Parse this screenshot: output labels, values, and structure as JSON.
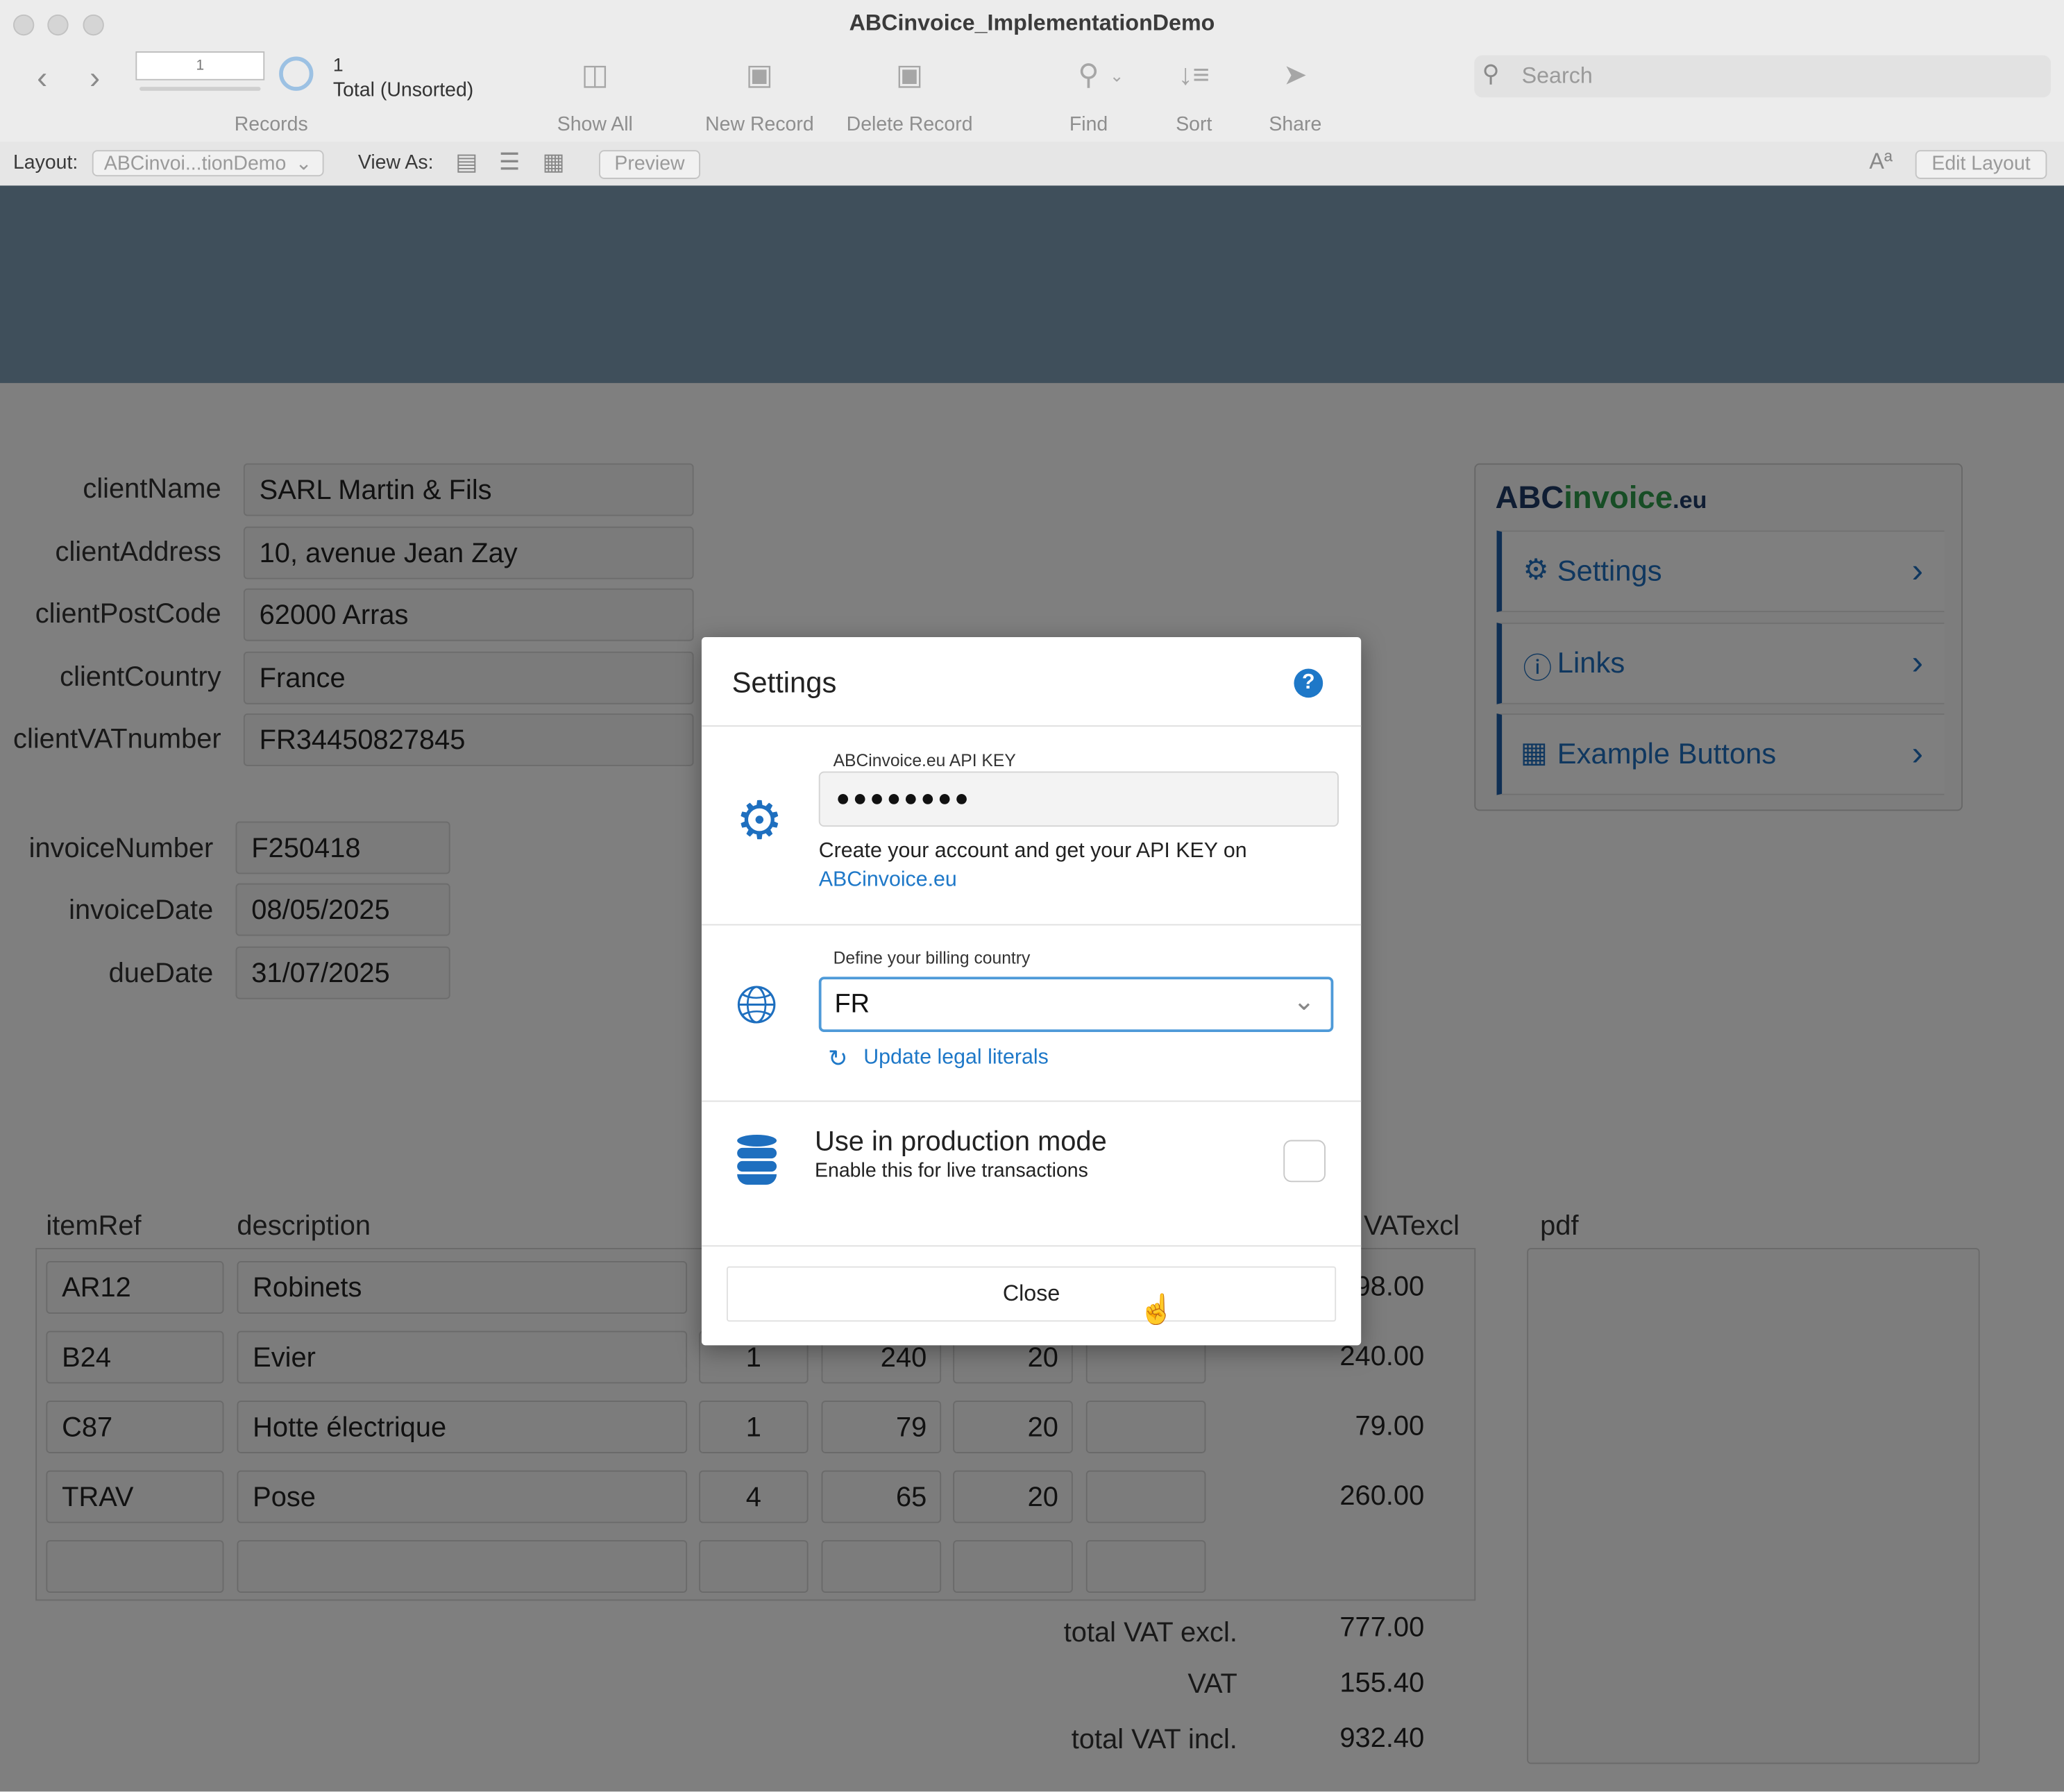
{
  "window": {
    "title": "ABCinvoice_ImplementationDemo"
  },
  "toolbar": {
    "record_current": "1",
    "record_total": "1",
    "record_status": "Total (Unsorted)",
    "records_label": "Records",
    "show_all": "Show All",
    "new_record": "New Record",
    "delete_record": "Delete Record",
    "find": "Find",
    "sort": "Sort",
    "share": "Share",
    "search_placeholder": "Search"
  },
  "layout_bar": {
    "layout_label": "Layout:",
    "layout_value": "ABCinvoi...tionDemo",
    "view_as_label": "View As:",
    "preview": "Preview",
    "font_icon_text": "Aª",
    "edit_layout": "Edit Layout"
  },
  "client": {
    "fields": [
      {
        "label": "clientName",
        "value": "SARL Martin & Fils"
      },
      {
        "label": "clientAddress",
        "value": "10, avenue Jean Zay"
      },
      {
        "label": "clientPostCode",
        "value": "62000 Arras"
      },
      {
        "label": "clientCountry",
        "value": "France"
      },
      {
        "label": "clientVATnumber",
        "value": "FR34450827845"
      }
    ]
  },
  "invoice": {
    "fields": [
      {
        "label": "invoiceNumber",
        "value": "F250418"
      },
      {
        "label": "invoiceDate",
        "value": "08/05/2025"
      },
      {
        "label": "dueDate",
        "value": "31/07/2025"
      }
    ]
  },
  "items_table": {
    "headers": {
      "itemRef": "itemRef",
      "description": "description",
      "vatexcl": "VATexcl",
      "pdf": "pdf"
    },
    "rows": [
      {
        "ref": "AR12",
        "description": "Robinets",
        "qty": "",
        "price": "",
        "vat": "",
        "discount": "",
        "total": "98.00"
      },
      {
        "ref": "B24",
        "description": "Evier",
        "qty": "1",
        "price": "240",
        "vat": "20",
        "discount": "",
        "total": "240.00"
      },
      {
        "ref": "C87",
        "description": "Hotte électrique",
        "qty": "1",
        "price": "79",
        "vat": "20",
        "discount": "",
        "total": "79.00"
      },
      {
        "ref": "TRAV",
        "description": "Pose",
        "qty": "4",
        "price": "65",
        "vat": "20",
        "discount": "",
        "total": "260.00"
      },
      {
        "ref": "",
        "description": "",
        "qty": "",
        "price": "",
        "vat": "",
        "discount": "",
        "total": ""
      }
    ]
  },
  "totals": [
    {
      "label": "total VAT excl.",
      "value": "777.00"
    },
    {
      "label": "VAT",
      "value": "155.40"
    },
    {
      "label": "total VAT incl.",
      "value": "932.40"
    }
  ],
  "abc_panel": {
    "logo_abc": "ABC",
    "logo_invoice": "invoice",
    "logo_eu": ".eu",
    "items": [
      {
        "label": "Settings",
        "icon": "gear-icon"
      },
      {
        "label": "Links",
        "icon": "info-icon"
      },
      {
        "label": "Example Buttons",
        "icon": "grid-icon"
      }
    ]
  },
  "dialog": {
    "title": "Settings",
    "api_key_label": "ABCinvoice.eu API KEY",
    "api_key_value": "●●●●●●●●",
    "api_help_text": "Create your account and get your API KEY on",
    "api_help_link": "ABCinvoice.eu",
    "country_label": "Define your billing country",
    "country_value": "FR",
    "update_link": "Update legal literals",
    "production_title": "Use in production mode",
    "production_subtitle": "Enable this for live transactions",
    "production_checked": false,
    "close_label": "Close"
  },
  "colors": {
    "accent": "#1e78c8",
    "header_band": "#7f9fb7",
    "menu_border": "#1e5fa8"
  }
}
